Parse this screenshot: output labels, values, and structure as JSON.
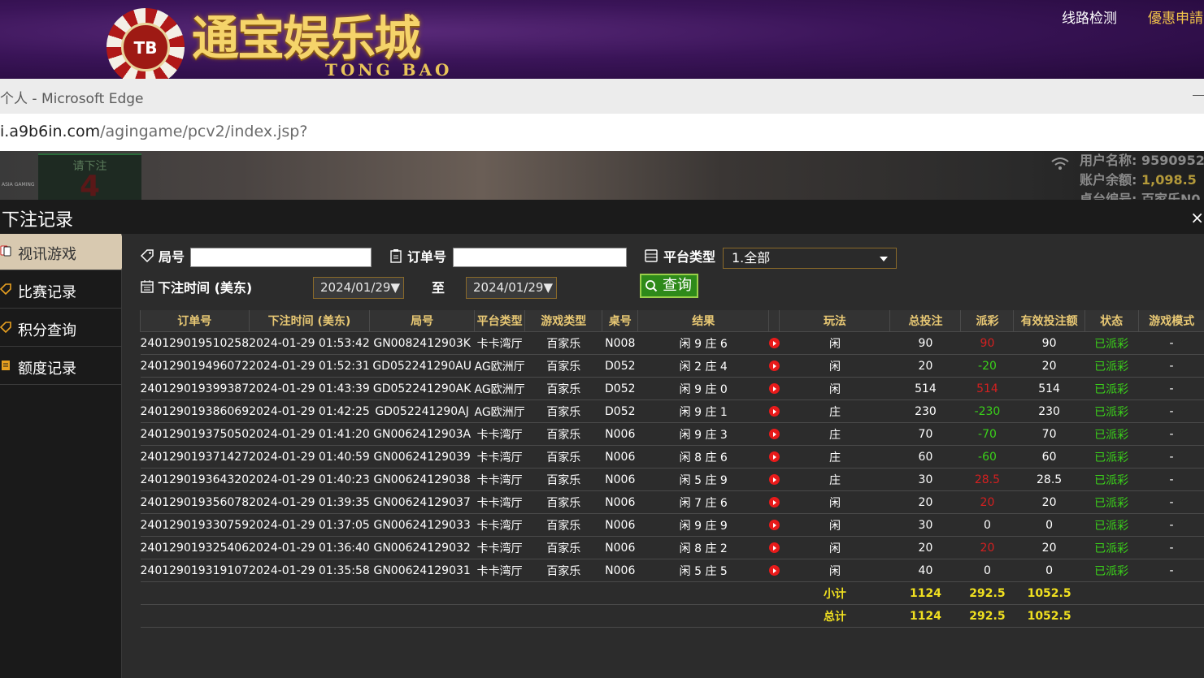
{
  "banner": {
    "logo_chip": "TB",
    "logo_cn": "通宝娱乐城",
    "logo_en": "TONG BAO",
    "links": [
      "线路检测",
      "優惠申請"
    ]
  },
  "browser": {
    "window_title": "个人 - Microsoft Edge",
    "url_host": "i.a9b6in.com",
    "url_path": "/agingame/pcv2/index.jsp?"
  },
  "game_strip": {
    "brand": "ASIA GAMING",
    "bet_prompt": "请下注",
    "countdown": "4",
    "user_label": "用户名称:",
    "user_value": "9590952",
    "balance_label": "账户余额:",
    "balance_value": "1,098.5",
    "table_label": "桌台编号:",
    "table_value": "百家乐N0"
  },
  "panel": {
    "title": "下注记录",
    "close": "×"
  },
  "sidebar": {
    "items": [
      {
        "label": "视讯游戏",
        "active": true
      },
      {
        "label": "比赛记录",
        "active": false
      },
      {
        "label": "积分查询",
        "active": false
      },
      {
        "label": "额度记录",
        "active": false
      }
    ]
  },
  "filters": {
    "round_label": "局号",
    "order_label": "订单号",
    "platform_label": "平台类型",
    "platform_value": "1.全部",
    "time_label": "下注时间 (美东)",
    "date_from": "2024/01/29",
    "date_sep": "至",
    "date_to": "2024/01/29",
    "query_label": "查询"
  },
  "table": {
    "columns": [
      "订单号",
      "下注时间 (美东)",
      "局号",
      "平台类型",
      "游戏类型",
      "桌号",
      "结果",
      "",
      "玩法",
      "总投注",
      "派彩",
      "有效投注额",
      "状态",
      "游戏模式"
    ],
    "rows": [
      [
        "240129019510258",
        "2024-01-29 01:53:42",
        "GN0082412903K",
        "卡卡湾厅",
        "百家乐",
        "N008",
        "闲 9 庄 6",
        "闲",
        "90",
        "90",
        "90",
        "已派彩",
        "-"
      ],
      [
        "240129019496072",
        "2024-01-29 01:52:31",
        "GD052241290AU",
        "AG欧洲厅",
        "百家乐",
        "D052",
        "闲 2 庄 4",
        "闲",
        "20",
        "-20",
        "20",
        "已派彩",
        "-"
      ],
      [
        "240129019399387",
        "2024-01-29 01:43:39",
        "GD052241290AK",
        "AG欧洲厅",
        "百家乐",
        "D052",
        "闲 9 庄 0",
        "闲",
        "514",
        "514",
        "514",
        "已派彩",
        "-"
      ],
      [
        "240129019386069",
        "2024-01-29 01:42:25",
        "GD052241290AJ",
        "AG欧洲厅",
        "百家乐",
        "D052",
        "闲 9 庄 1",
        "庄",
        "230",
        "-230",
        "230",
        "已派彩",
        "-"
      ],
      [
        "240129019375050",
        "2024-01-29 01:41:20",
        "GN0062412903A",
        "卡卡湾厅",
        "百家乐",
        "N006",
        "闲 9 庄 3",
        "庄",
        "70",
        "-70",
        "70",
        "已派彩",
        "-"
      ],
      [
        "240129019371427",
        "2024-01-29 01:40:59",
        "GN00624129039",
        "卡卡湾厅",
        "百家乐",
        "N006",
        "闲 8 庄 6",
        "庄",
        "60",
        "-60",
        "60",
        "已派彩",
        "-"
      ],
      [
        "240129019364320",
        "2024-01-29 01:40:23",
        "GN00624129038",
        "卡卡湾厅",
        "百家乐",
        "N006",
        "闲 5 庄 9",
        "庄",
        "30",
        "28.5",
        "28.5",
        "已派彩",
        "-"
      ],
      [
        "240129019356078",
        "2024-01-29 01:39:35",
        "GN00624129037",
        "卡卡湾厅",
        "百家乐",
        "N006",
        "闲 7 庄 6",
        "闲",
        "20",
        "20",
        "20",
        "已派彩",
        "-"
      ],
      [
        "240129019330759",
        "2024-01-29 01:37:05",
        "GN00624129033",
        "卡卡湾厅",
        "百家乐",
        "N006",
        "闲 9 庄 9",
        "闲",
        "30",
        "0",
        "0",
        "已派彩",
        "-"
      ],
      [
        "240129019325406",
        "2024-01-29 01:36:40",
        "GN00624129032",
        "卡卡湾厅",
        "百家乐",
        "N006",
        "闲 8 庄 2",
        "闲",
        "20",
        "20",
        "20",
        "已派彩",
        "-"
      ],
      [
        "240129019319107",
        "2024-01-29 01:35:58",
        "GN00624129031",
        "卡卡湾厅",
        "百家乐",
        "N006",
        "闲 5 庄 5",
        "闲",
        "40",
        "0",
        "0",
        "已派彩",
        "-"
      ]
    ],
    "subtotal": {
      "label": "小计",
      "total_bet": "1124",
      "payout": "292.5",
      "valid_bet": "1052.5"
    },
    "total": {
      "label": "总计",
      "total_bet": "1124",
      "payout": "292.5",
      "valid_bet": "1052.5"
    }
  },
  "colors": {
    "header_text": "#e8c874",
    "payout_positive": "#d42020",
    "payout_negative": "#3ad01a",
    "status_paid": "#3ad01a",
    "summary": "#f0e020",
    "query_button": "#2e8a1a"
  }
}
